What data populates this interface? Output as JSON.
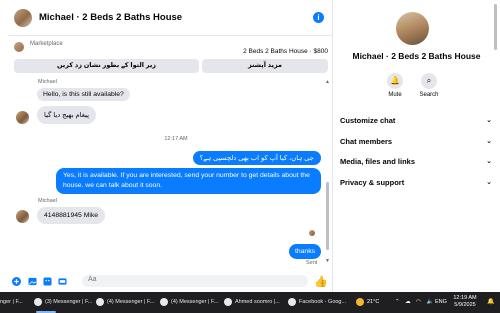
{
  "chat": {
    "title": "Michael · 2 Beds 2 Baths House",
    "marketplace_label": "Marketplace",
    "listing": "2 Beds 2 Baths House · $800",
    "btn_mark": "زیر التوا کے بطور نشان زد کریں",
    "btn_more": "مزید آپشنز",
    "sender_top": "Michael",
    "msg1": "Hello, is this still available?",
    "msg2": "پیغام بھیج دیا گیا",
    "timestamp": "12:17 AM",
    "out1": "جی ہاں، کیا آپ کو اب بھی دلچسپی ہے؟",
    "out2": "Yes, it is available. If you are interested, send your number to get details about the house. we can talk about it soon.",
    "sender2": "Michael",
    "msg3": "4148881945 Mike",
    "out3": "thanks",
    "sent_label": "Sent",
    "composer_placeholder": "Aa"
  },
  "info": {
    "name": "Michael · 2 Beds 2 Baths House",
    "mute": "Mute",
    "search": "Search",
    "menu": [
      "Customize chat",
      "Chat members",
      "Media, files and links",
      "Privacy & support"
    ]
  },
  "taskbar": {
    "items": [
      "nger | F...",
      "(3) Messenger | F...",
      "(4) Messenger | F...",
      "(4) Messenger | F...",
      "Ahmed soomro |...",
      "Facebook - Goog..."
    ],
    "weather": "21°C",
    "lang": "ENG",
    "time": "12:19 AM",
    "date": "5/9/2025"
  },
  "colors": {
    "accent": "#0a7cff",
    "bubble_in": "#e4e6eb",
    "taskbar": "#1f1f22"
  }
}
